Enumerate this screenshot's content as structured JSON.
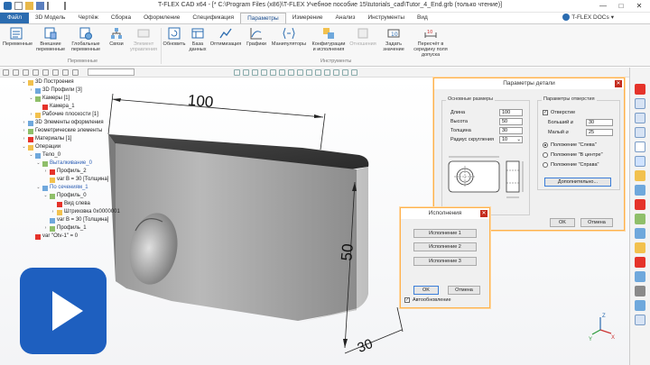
{
  "window": {
    "title": "T-FLEX CAD x64 - [* C:\\Program Files (x86)\\T-FLEX Учебное пособие 15\\tutorials_cad\\Tutor_4_End.grb (только чтение)]",
    "docs_label": "T-FLEX DOCs",
    "controls": [
      "—",
      "□",
      "✕"
    ]
  },
  "ribbon": {
    "tabs": [
      "Файл",
      "3D Модель",
      "Чертёж",
      "Сборка",
      "Оформление",
      "Спецификация",
      "Параметры",
      "Измерение",
      "Анализ",
      "Инструменты",
      "Вид"
    ],
    "active_tab": "Параметры",
    "buttons": [
      {
        "label": "Переменные",
        "icon": "variables-icon"
      },
      {
        "label": "Внешние переменные",
        "icon": "external-variables-icon"
      },
      {
        "label": "Глобальные переменные",
        "icon": "global-variables-icon"
      },
      {
        "label": "Связи",
        "icon": "links-icon"
      },
      {
        "label": "Элемент управления",
        "icon": "control-element-icon",
        "disabled": true
      },
      {
        "label": "Обновить",
        "icon": "refresh-icon"
      },
      {
        "label": "База данных",
        "icon": "database-icon"
      },
      {
        "label": "Оптимизация",
        "icon": "optimization-icon"
      },
      {
        "label": "Графики",
        "icon": "graphs-icon"
      },
      {
        "label": "Манипуляторы",
        "icon": "manipulators-icon"
      },
      {
        "label": "Конфигурации и исполнения",
        "icon": "configurations-icon"
      },
      {
        "label": "Отношения",
        "icon": "relations-icon",
        "disabled": true
      },
      {
        "label": "Задать значение",
        "icon": "set-value-icon"
      },
      {
        "label": "Пересчёт в середину поля допуска",
        "icon": "tolerance-recalc-icon"
      }
    ],
    "groups": [
      "Переменные",
      "Инструменты"
    ]
  },
  "tree": {
    "nodes": [
      {
        "label": "3D Построения",
        "indent": 0,
        "expander": "⌄"
      },
      {
        "label": "3D Профили [3]",
        "indent": 1,
        "expander": "›"
      },
      {
        "label": "Камеры [1]",
        "indent": 1,
        "expander": "⌄"
      },
      {
        "label": "Камера_1",
        "indent": 2,
        "expander": ""
      },
      {
        "label": "Рабочие плоскости [1]",
        "indent": 1,
        "expander": "›"
      },
      {
        "label": "3D Элементы оформления",
        "indent": 0,
        "expander": "›"
      },
      {
        "label": "Геометрические элементы",
        "indent": 0,
        "expander": "›"
      },
      {
        "label": "Материалы [1]",
        "indent": 0,
        "expander": "›"
      },
      {
        "label": "Операции",
        "indent": 0,
        "expander": "⌄"
      },
      {
        "label": "Тело_0",
        "indent": 1,
        "expander": "⌄"
      },
      {
        "label": "Выталкивание_0",
        "indent": 2,
        "expander": "⌄",
        "blue": true
      },
      {
        "label": "Профиль_2",
        "indent": 3,
        "expander": "›"
      },
      {
        "label": "var B = 30 [Толщина]",
        "indent": 3,
        "expander": ""
      },
      {
        "label": "По сечениям_1",
        "indent": 2,
        "expander": "⌄",
        "blue": true
      },
      {
        "label": "Профиль_0",
        "indent": 3,
        "expander": "⌄"
      },
      {
        "label": "Вид слева",
        "indent": 4,
        "expander": ""
      },
      {
        "label": "Штриховка 0x0000001",
        "indent": 4,
        "expander": "›"
      },
      {
        "label": "var B = 30 [Толщина]",
        "indent": 3,
        "expander": ""
      },
      {
        "label": "Профиль_1",
        "indent": 3,
        "expander": "›"
      },
      {
        "label": "var \"Otv-1\" = 0",
        "indent": 1,
        "expander": ""
      }
    ]
  },
  "model": {
    "dim_length": "100",
    "dim_height": "50",
    "dim_thickness": "30"
  },
  "params_dialog": {
    "title": "Параметры детали",
    "main_group": "Основные размеры",
    "fields": [
      {
        "label": "Длина",
        "value": "100"
      },
      {
        "label": "Высота",
        "value": "50"
      },
      {
        "label": "Толщина",
        "value": "30"
      },
      {
        "label": "Радиус скругления",
        "value": "10"
      }
    ],
    "hole_group": "Параметры отверстия",
    "hole_checkbox": "Отверстие",
    "hole_fields": [
      {
        "label": "Больший ⌀",
        "value": "30"
      },
      {
        "label": "Малый ⌀",
        "value": "25"
      }
    ],
    "positions": [
      "Положение \"Слева\"",
      "Положение \"В центре\"",
      "Положение \"Справа\""
    ],
    "selected_position": 0,
    "more_button": "Дополнительно...",
    "ok": "OK",
    "cancel": "Отмена"
  },
  "exec_dialog": {
    "title": "Исполнения",
    "buttons": [
      "Исполнение 1",
      "Исполнение 2",
      "Исполнение 3"
    ],
    "ok": "OK",
    "cancel": "Отмена",
    "auto_update": "Автообновление"
  },
  "colors": {
    "accent": "#2b6cb0",
    "dialog_border": "#ffb24d",
    "play": "#1e5fbf"
  }
}
